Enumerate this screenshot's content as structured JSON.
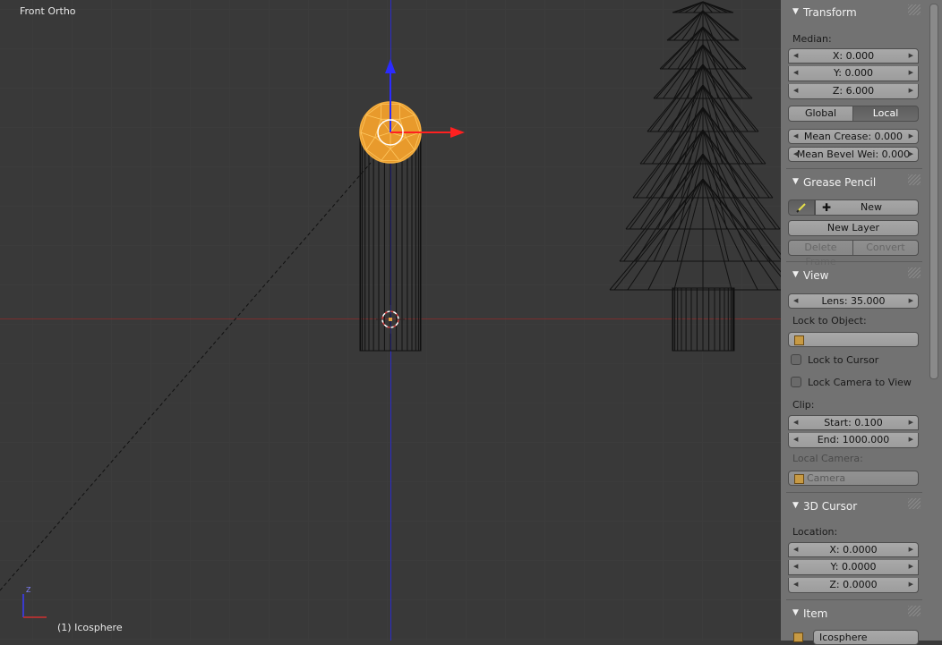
{
  "viewport": {
    "view_name": "Front Ortho",
    "object_info": "(1) Icosphere",
    "axis_z_label": "Z"
  },
  "colors": {
    "selected_object": "#f0a030",
    "x_axis": "#ff2020",
    "z_axis": "#2a2aff",
    "panel_bg": "#727272",
    "viewport_bg": "#393939"
  },
  "transform": {
    "title": "Transform",
    "median_label": "Median:",
    "x": "X: 0.000",
    "y": "Y: 0.000",
    "z": "Z: 6.000",
    "global_label": "Global",
    "local_label": "Local",
    "active_space": "Local",
    "mean_crease": "Mean Crease: 0.000",
    "mean_bevel": "Mean Bevel Wei: 0.000"
  },
  "grease_pencil": {
    "title": "Grease Pencil",
    "new_label": "New",
    "new_layer_label": "New Layer",
    "delete_frame_label": "Delete Frame",
    "convert_label": "Convert"
  },
  "view": {
    "title": "View",
    "lens": "Lens: 35.000",
    "lock_to_object_label": "Lock to Object:",
    "lock_to_cursor_label": "Lock to Cursor",
    "lock_camera_label": "Lock Camera to View",
    "clip_label": "Clip:",
    "clip_start": "Start: 0.100",
    "clip_end": "End: 1000.000",
    "local_camera_label": "Local Camera:",
    "camera_value": "Camera"
  },
  "cursor": {
    "title": "3D Cursor",
    "location_label": "Location:",
    "x": "X: 0.0000",
    "y": "Y: 0.0000",
    "z": "Z: 0.0000"
  },
  "item": {
    "title": "Item",
    "name": "Icosphere"
  }
}
